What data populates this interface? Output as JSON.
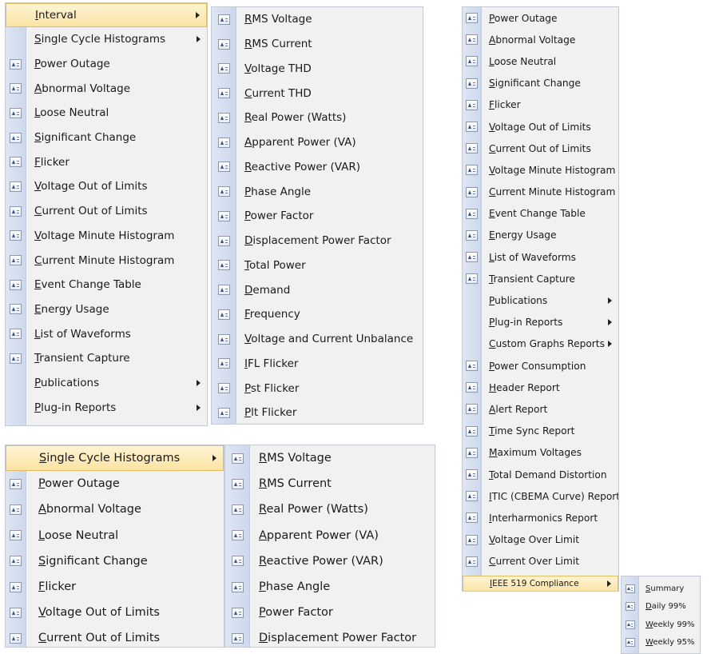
{
  "menu_a": {
    "items": [
      {
        "label": "Interval",
        "icon": "none",
        "submenu": true,
        "highlighted": true
      },
      {
        "label": "Single Cycle Histograms",
        "icon": "none",
        "submenu": true
      },
      {
        "label": "Power Outage",
        "icon": "report-icon"
      },
      {
        "label": "Abnormal Voltage",
        "icon": "report-icon"
      },
      {
        "label": "Loose Neutral",
        "icon": "report-icon"
      },
      {
        "label": "Significant Change",
        "icon": "report-icon"
      },
      {
        "label": "Flicker",
        "icon": "report-icon"
      },
      {
        "label": "Voltage Out of Limits",
        "icon": "report-icon"
      },
      {
        "label": "Current Out of Limits",
        "icon": "report-icon"
      },
      {
        "label": "Voltage Minute Histogram",
        "icon": "report-icon"
      },
      {
        "label": "Current Minute Histogram",
        "icon": "report-icon"
      },
      {
        "label": "Event Change Table",
        "icon": "report-icon"
      },
      {
        "label": "Energy Usage",
        "icon": "report-icon"
      },
      {
        "label": "List of Waveforms",
        "icon": "report-icon"
      },
      {
        "label": "Transient Capture",
        "icon": "report-icon"
      },
      {
        "label": "Publications",
        "icon": "none",
        "submenu": true
      },
      {
        "label": "Plug-in Reports",
        "icon": "none",
        "submenu": true
      }
    ]
  },
  "menu_b": {
    "items": [
      {
        "label": "RMS Voltage",
        "icon": "report-icon"
      },
      {
        "label": "RMS Current",
        "icon": "report-icon"
      },
      {
        "label": "Voltage THD",
        "icon": "report-icon"
      },
      {
        "label": "Current THD",
        "icon": "report-icon"
      },
      {
        "label": "Real Power (Watts)",
        "icon": "report-icon"
      },
      {
        "label": "Apparent Power (VA)",
        "icon": "report-icon"
      },
      {
        "label": "Reactive Power (VAR)",
        "icon": "report-icon"
      },
      {
        "label": "Phase Angle",
        "icon": "report-icon"
      },
      {
        "label": "Power Factor",
        "icon": "report-icon"
      },
      {
        "label": "Displacement Power Factor",
        "icon": "report-icon"
      },
      {
        "label": "Total Power",
        "icon": "report-icon"
      },
      {
        "label": "Demand",
        "icon": "report-icon"
      },
      {
        "label": "Frequency",
        "icon": "report-icon"
      },
      {
        "label": "Voltage and Current Unbalance",
        "icon": "report-icon"
      },
      {
        "label": "IFL Flicker",
        "icon": "report-icon"
      },
      {
        "label": "Pst Flicker",
        "icon": "report-icon"
      },
      {
        "label": "Plt Flicker",
        "icon": "report-icon"
      }
    ]
  },
  "menu_c": {
    "items": [
      {
        "label": "Single Cycle Histograms",
        "icon": "none",
        "submenu": true,
        "highlighted": true
      },
      {
        "label": "Power Outage",
        "icon": "report-icon"
      },
      {
        "label": "Abnormal Voltage",
        "icon": "report-icon"
      },
      {
        "label": "Loose Neutral",
        "icon": "report-icon"
      },
      {
        "label": "Significant Change",
        "icon": "report-icon"
      },
      {
        "label": "Flicker",
        "icon": "report-icon"
      },
      {
        "label": "Voltage Out of Limits",
        "icon": "report-icon"
      },
      {
        "label": "Current Out of Limits",
        "icon": "report-icon"
      }
    ]
  },
  "menu_d": {
    "items": [
      {
        "label": "RMS Voltage",
        "icon": "report-icon"
      },
      {
        "label": "RMS Current",
        "icon": "report-icon"
      },
      {
        "label": "Real Power (Watts)",
        "icon": "report-icon"
      },
      {
        "label": "Apparent Power (VA)",
        "icon": "report-icon"
      },
      {
        "label": "Reactive Power (VAR)",
        "icon": "report-icon"
      },
      {
        "label": "Phase Angle",
        "icon": "report-icon"
      },
      {
        "label": "Power Factor",
        "icon": "report-icon"
      },
      {
        "label": "Displacement Power Factor",
        "icon": "report-icon"
      }
    ]
  },
  "menu_e": {
    "items": [
      {
        "label": "Power Outage",
        "icon": "report-icon"
      },
      {
        "label": "Abnormal Voltage",
        "icon": "report-icon"
      },
      {
        "label": "Loose Neutral",
        "icon": "report-icon"
      },
      {
        "label": "Significant Change",
        "icon": "report-icon"
      },
      {
        "label": "Flicker",
        "icon": "report-icon"
      },
      {
        "label": "Voltage Out of Limits",
        "icon": "report-icon"
      },
      {
        "label": "Current Out of Limits",
        "icon": "report-icon"
      },
      {
        "label": "Voltage Minute Histogram",
        "icon": "report-icon"
      },
      {
        "label": "Current Minute Histogram",
        "icon": "report-icon"
      },
      {
        "label": "Event Change Table",
        "icon": "report-icon"
      },
      {
        "label": "Energy Usage",
        "icon": "report-icon"
      },
      {
        "label": "List of Waveforms",
        "icon": "report-icon"
      },
      {
        "label": "Transient Capture",
        "icon": "report-icon"
      },
      {
        "label": "Publications",
        "icon": "none",
        "submenu": true
      },
      {
        "label": "Plug-in Reports",
        "icon": "none",
        "submenu": true
      },
      {
        "label": "Custom Graphs Reports",
        "icon": "none",
        "submenu": true
      },
      {
        "label": "Power Consumption",
        "icon": "report-icon"
      },
      {
        "label": "Header Report",
        "icon": "report-icon"
      },
      {
        "label": "Alert Report",
        "icon": "report-icon"
      },
      {
        "label": "Time Sync Report",
        "icon": "report-icon"
      },
      {
        "label": "Maximum Voltages",
        "icon": "report-icon"
      },
      {
        "label": "Total Demand Distortion",
        "icon": "report-icon"
      },
      {
        "label": "ITIC (CBEMA Curve) Report",
        "icon": "report-icon"
      },
      {
        "label": "Interharmonics Report",
        "icon": "report-icon"
      },
      {
        "label": "Voltage Over Limit",
        "icon": "report-icon"
      },
      {
        "label": "Current Over Limit",
        "icon": "report-icon"
      },
      {
        "label": "IEEE 519 Compliance",
        "icon": "none",
        "submenu": true,
        "highlighted": true
      }
    ]
  },
  "menu_f": {
    "items": [
      {
        "label": "Summary",
        "icon": "report-icon"
      },
      {
        "label": "Daily 99%",
        "icon": "report-icon"
      },
      {
        "label": "Weekly 99%",
        "icon": "report-icon"
      },
      {
        "label": "Weekly 95%",
        "icon": "report-icon"
      }
    ]
  },
  "colors": {
    "menu_background": "#f1f1f1",
    "gutter": "#d6dff0",
    "highlight_top": "#fff4d4",
    "highlight_bottom": "#fbe3a3",
    "highlight_border": "#e3bd66",
    "border": "#c4c9d4"
  }
}
